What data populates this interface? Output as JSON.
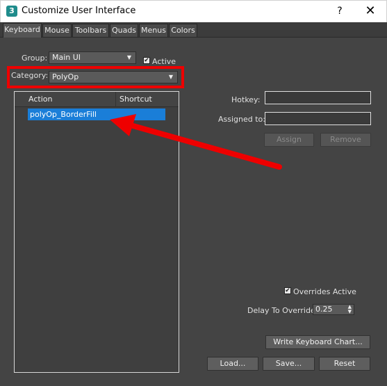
{
  "window": {
    "title": "Customize User Interface",
    "help_label": "?",
    "close_label": "✕",
    "app_icon_label": "3"
  },
  "tabs": [
    {
      "label": "Keyboard",
      "active": true
    },
    {
      "label": "Mouse",
      "active": false
    },
    {
      "label": "Toolbars",
      "active": false
    },
    {
      "label": "Quads",
      "active": false
    },
    {
      "label": "Menus",
      "active": false
    },
    {
      "label": "Colors",
      "active": false
    }
  ],
  "group": {
    "label": "Group:",
    "value": "Main UI",
    "active_label": "Active",
    "active_checked": true
  },
  "category": {
    "label": "Category:",
    "value": "PolyOp"
  },
  "action_list": {
    "columns": [
      "Action",
      "Shortcut"
    ],
    "rows": [
      {
        "action": "polyOp_BorderFill",
        "shortcut": "",
        "selected": true
      }
    ]
  },
  "hotkey": {
    "label": "Hotkey:",
    "value": ""
  },
  "assigned_to": {
    "label": "Assigned to:",
    "value": ""
  },
  "buttons": {
    "assign": "Assign",
    "remove": "Remove",
    "write_chart": "Write Keyboard Chart...",
    "load": "Load...",
    "save": "Save...",
    "reset": "Reset"
  },
  "overrides": {
    "label": "Overrides Active",
    "checked": true,
    "delay_label": "Delay To Override:",
    "delay_value": "0.25"
  },
  "colors": {
    "annotation_red": "#ee0000",
    "selection_blue": "#1a7ed8"
  }
}
